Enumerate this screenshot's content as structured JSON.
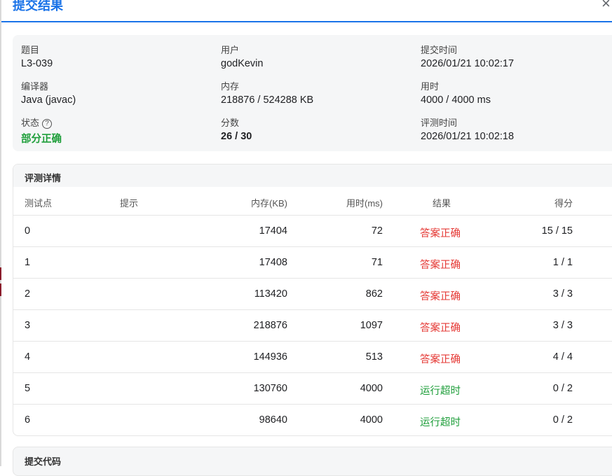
{
  "dialog": {
    "title": "提交结果",
    "close_label": "×"
  },
  "info": {
    "problem_label": "题目",
    "problem": "L3-039",
    "user_label": "用户",
    "user": "godKevin",
    "submit_time_label": "提交时间",
    "submit_time": "2026/01/21 10:02:17",
    "compiler_label": "编译器",
    "compiler": "Java (javac)",
    "memory_label": "内存",
    "memory": "218876 / 524288 KB",
    "time_label": "用时",
    "time": "4000 / 4000 ms",
    "status_label": "状态",
    "status_help": "?",
    "status": "部分正确",
    "score_label": "分数",
    "score": "26 / 30",
    "judge_time_label": "评测时间",
    "judge_time": "2026/01/21 10:02:18"
  },
  "details": {
    "title": "评测详情",
    "headers": [
      "测试点",
      "提示",
      "内存(KB)",
      "用时(ms)",
      "结果",
      "得分"
    ],
    "rows": [
      {
        "id": "0",
        "hint": "",
        "memory": "17404",
        "time": "72",
        "result": "答案正确",
        "score": "15 / 15"
      },
      {
        "id": "1",
        "hint": "",
        "memory": "17408",
        "time": "71",
        "result": "答案正确",
        "score": "1 / 1"
      },
      {
        "id": "2",
        "hint": "",
        "memory": "113420",
        "time": "862",
        "result": "答案正确",
        "score": "3 / 3"
      },
      {
        "id": "3",
        "hint": "",
        "memory": "218876",
        "time": "1097",
        "result": "答案正确",
        "score": "3 / 3"
      },
      {
        "id": "4",
        "hint": "",
        "memory": "144936",
        "time": "513",
        "result": "答案正确",
        "score": "4 / 4"
      },
      {
        "id": "5",
        "hint": "",
        "memory": "130760",
        "time": "4000",
        "result": "运行超时",
        "score": "0 / 2"
      },
      {
        "id": "6",
        "hint": "",
        "memory": "98640",
        "time": "4000",
        "result": "运行超时",
        "score": "0 / 2"
      }
    ]
  },
  "code_section": {
    "title": "提交代码"
  },
  "colors": {
    "accent": "#1a73e8",
    "accepted": "#e53935",
    "timeout": "#1e9e3a",
    "partial": "#1e9e3a"
  }
}
